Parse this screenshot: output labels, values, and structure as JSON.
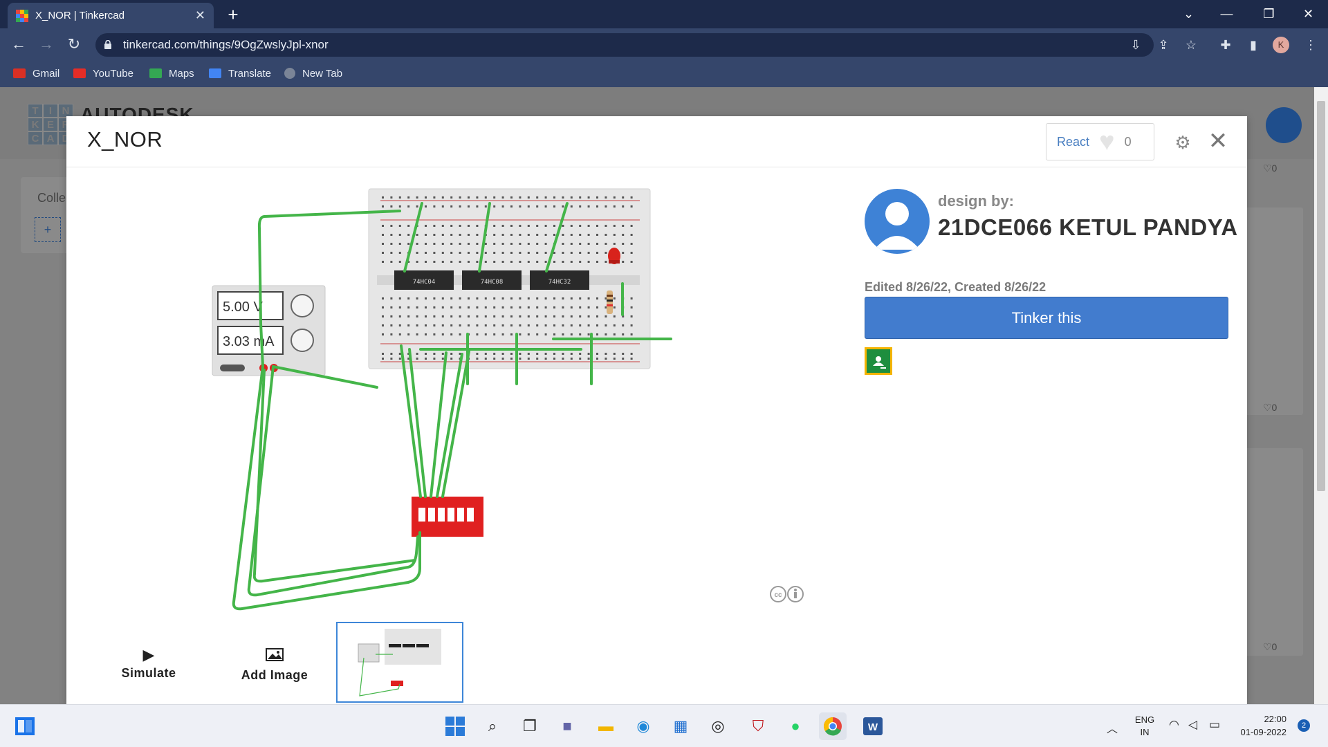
{
  "browser": {
    "tab_title": "X_NOR | Tinkercad",
    "tab_close": "✕",
    "new_tab": "+",
    "url": "tinkercad.com/things/9OgZwslyJpl-xnor",
    "profile_initial": "K",
    "bookmarks": [
      {
        "label": "Gmail",
        "color": "#d93025"
      },
      {
        "label": "YouTube",
        "color": "#e52d27"
      },
      {
        "label": "Maps",
        "color": "#34a853"
      },
      {
        "label": "Translate",
        "color": "#4285f4"
      },
      {
        "label": "New Tab",
        "color": "#7b8597"
      }
    ]
  },
  "site": {
    "logo_letters": [
      "T",
      "I",
      "N",
      "K",
      "E",
      "R",
      "C",
      "A",
      "D"
    ],
    "brand": "AUTODESK",
    "collections_label": "Colle",
    "add_label": "+",
    "like_counts": [
      "♡0",
      "♡0",
      "♡0"
    ]
  },
  "modal": {
    "title": "X_NOR",
    "react_label": "React",
    "react_count": "0",
    "close": "✕",
    "design_by": "design by:",
    "author": "21DCE066 KETUL PANDYA",
    "edited": "Edited 8/26/22, Created 8/26/22",
    "tinker_button": "Tinker this",
    "simulate_label": "Simulate",
    "add_image_label": "Add Image"
  },
  "circuit": {
    "voltage": "5.00 V",
    "current": "3.03 mA",
    "chips": [
      "74HC04",
      "74HC08",
      "74HC32"
    ],
    "wire_color": "#44b549",
    "breadboard_color": "#e6e6e6",
    "dip_switch_color": "#e02020"
  },
  "taskbar": {
    "lang_line1": "ENG",
    "lang_line2": "IN",
    "time": "22:00",
    "date": "01-09-2022",
    "notification_count": "2"
  },
  "colors": {
    "tab_strip": "#1d2a4a",
    "toolbar": "#35466b",
    "accent_button": "#427cce",
    "react_text": "#4a7fc1"
  }
}
